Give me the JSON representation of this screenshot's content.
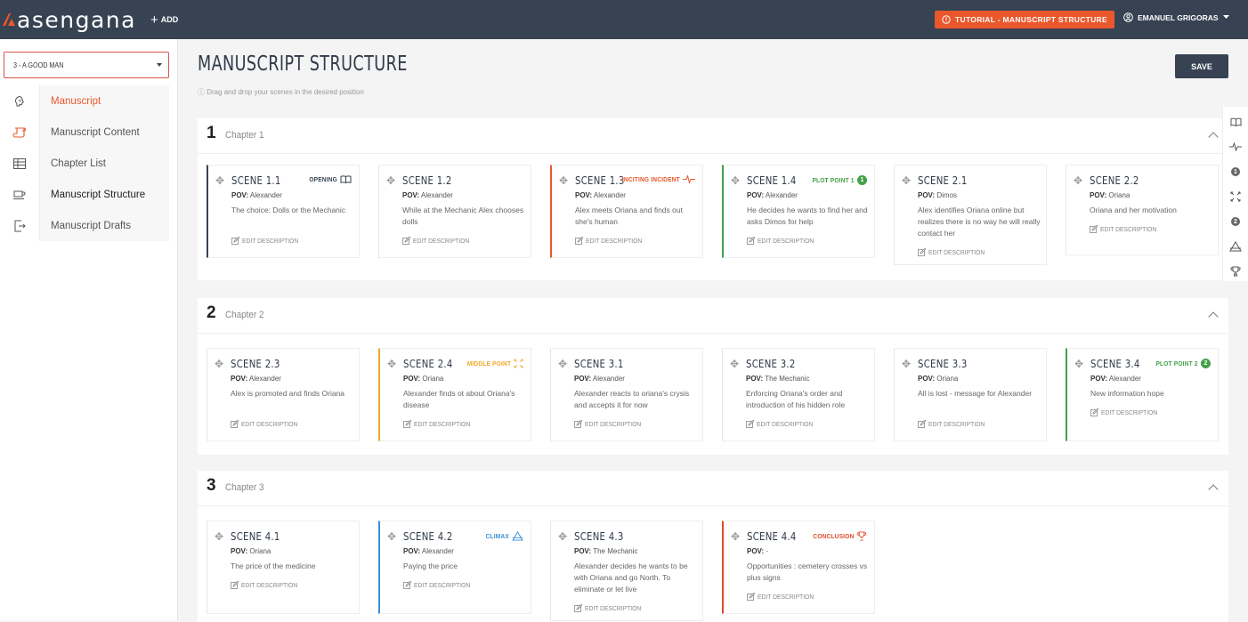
{
  "header": {
    "logo_text": "asengana",
    "add_label": "ADD",
    "tutorial_label": "TUTORIAL - MANUSCRIPT STRUCTURE",
    "user_name": "EMANUEL GRIGORAS"
  },
  "colors": {
    "accent": "#e9572b",
    "dark": "#374352",
    "opening": "#374352",
    "inciting": "#e9572b",
    "plot_point": "#43a047",
    "middle": "#f0a92a",
    "climax": "#3a8fd6",
    "conclusion": "#e04b2c"
  },
  "sidebar": {
    "book_select": "3 - A GOOD MAN",
    "items": [
      {
        "label": "Manuscript",
        "icon": "brain-icon"
      },
      {
        "label": "Manuscript Content",
        "icon": "scroll-icon"
      },
      {
        "label": "Chapter List",
        "icon": "table-icon"
      },
      {
        "label": "Manuscript Structure",
        "icon": "coffee-icon"
      },
      {
        "label": "Manuscript Drafts",
        "icon": "export-icon"
      }
    ]
  },
  "main": {
    "title": "MANUSCRIPT STRUCTURE",
    "hint": "ⓘ Drag and drop your scenes in the desired position",
    "save_label": "SAVE",
    "edit_label": "EDIT DESCRIPTION",
    "pov_label": "POV:",
    "chapters": [
      {
        "number": "1",
        "name": "Chapter 1",
        "scenes": [
          {
            "title": "SCENE 1.1",
            "pov": "Alexander",
            "desc": "The choice: Dolls or the Mechanic",
            "badge": "OPENING",
            "badge_type": "opening"
          },
          {
            "title": "SCENE 1.2",
            "pov": "Alexander",
            "desc": "While at the Mechanic Alex chooses dolls",
            "badge": "",
            "badge_type": ""
          },
          {
            "title": "SCENE 1.3",
            "pov": "Alexander",
            "desc": "Alex meets Oriana and finds out she's human",
            "badge": "INCITING INCIDENT",
            "badge_type": "inciting"
          },
          {
            "title": "SCENE 1.4",
            "pov": "Alexander",
            "desc": "He decides he wants to find her and asks Dimos for help",
            "badge": "PLOT POINT 1",
            "badge_type": "plot1"
          },
          {
            "title": "SCENE 2.1",
            "pov": "Dimos",
            "desc": "Alex identifies Oriana online but realizes there is no way he will really contact her",
            "badge": "",
            "badge_type": ""
          },
          {
            "title": "SCENE 2.2",
            "pov": "Oriana",
            "desc": "Oriana and her motivation",
            "badge": "",
            "badge_type": ""
          }
        ]
      },
      {
        "number": "2",
        "name": "Chapter 2",
        "scenes": [
          {
            "title": "SCENE 2.3",
            "pov": "Alexander",
            "desc": "Alex is promoted and finds Oriana",
            "badge": "",
            "badge_type": ""
          },
          {
            "title": "SCENE 2.4",
            "pov": "Oriana",
            "desc": "Alexander finds ot about Oriana's disease",
            "badge": "MIDDLE POINT",
            "badge_type": "middle"
          },
          {
            "title": "SCENE 3.1",
            "pov": "Alexander",
            "desc": "Alexander reacts to oriana's crysis and accepts it for now",
            "badge": "",
            "badge_type": ""
          },
          {
            "title": "SCENE 3.2",
            "pov": "The Mechanic",
            "desc": "Enforcing Oriana's order and introduction of his hidden role",
            "badge": "",
            "badge_type": ""
          },
          {
            "title": "SCENE 3.3",
            "pov": "Oriana",
            "desc": "All is lost - message for Alexander",
            "badge": "",
            "badge_type": ""
          },
          {
            "title": "SCENE 3.4",
            "pov": "Alexander",
            "desc": "New information hope",
            "badge": "PLOT POINT 2",
            "badge_type": "plot2"
          }
        ]
      },
      {
        "number": "3",
        "name": "Chapter 3",
        "scenes": [
          {
            "title": "SCENE 4.1",
            "pov": "Oriana",
            "desc": "The price of the medicine",
            "badge": "",
            "badge_type": ""
          },
          {
            "title": "SCENE 4.2",
            "pov": "Alexander",
            "desc": "Paying the price",
            "badge": "CLIMAX",
            "badge_type": "climax"
          },
          {
            "title": "SCENE 4.3",
            "pov": "The Mechanic",
            "desc": "Alexander decides he wants to be with Oriana and go North. To eliminate or let live",
            "badge": "",
            "badge_type": ""
          },
          {
            "title": "SCENE 4.4",
            "pov": "-",
            "desc": "Opportunities : cemetery crosses vs plus signs",
            "badge": "CONCLUSION",
            "badge_type": "conclusion"
          }
        ]
      }
    ]
  },
  "right_rail": {
    "icons": [
      "book-icon",
      "pulse-icon",
      "number-1-icon",
      "arrows-icon",
      "number-2-icon",
      "triangle-icon",
      "trophy-icon"
    ],
    "num1": "1",
    "num2": "2"
  }
}
